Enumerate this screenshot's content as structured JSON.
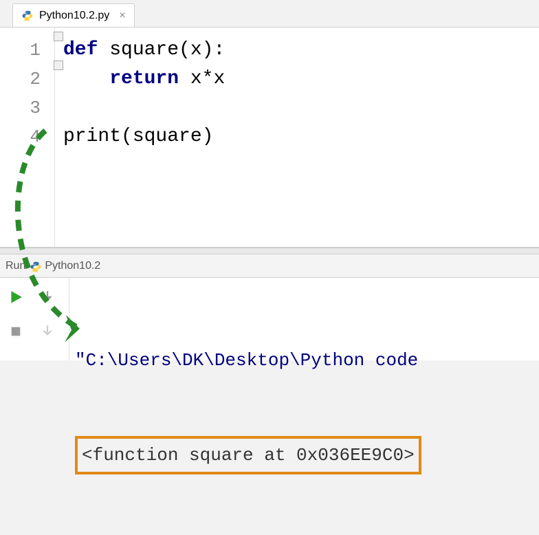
{
  "tab": {
    "filename": "Python10.2.py"
  },
  "editor": {
    "lines": [
      "1",
      "2",
      "3",
      "4",
      "",
      ""
    ],
    "code": {
      "l1_def": "def",
      "l1_rest": " square(x):",
      "l2_ret": "return",
      "l2_rest": " x*x",
      "l4_fn": "print",
      "l4_rest": "(square)"
    }
  },
  "run": {
    "label": "Run",
    "config": "Python10.2"
  },
  "console": {
    "path": "\"C:\\Users\\DK\\Desktop\\Python code",
    "result": "<function square at 0x036EE9C0>"
  }
}
